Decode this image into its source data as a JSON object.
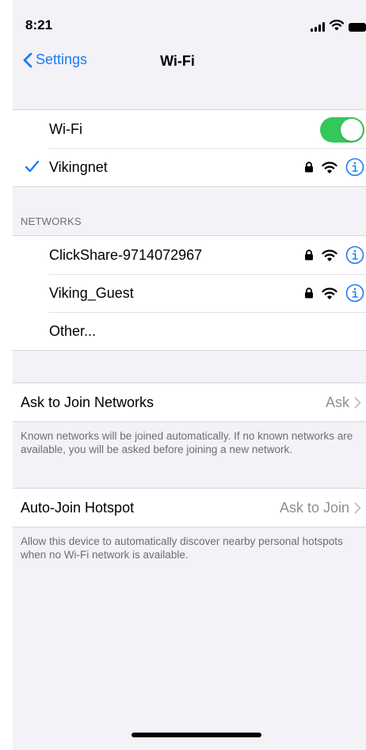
{
  "status_bar": {
    "time": "8:21"
  },
  "nav": {
    "back_label": "Settings",
    "title": "Wi-Fi"
  },
  "wifi_toggle": {
    "label": "Wi-Fi",
    "enabled": true,
    "on_color": "#34c759"
  },
  "connected_network": {
    "name": "Vikingnet",
    "secured": true,
    "icons": [
      "checkmark-icon",
      "lock-icon",
      "wifi-icon",
      "info-icon"
    ]
  },
  "networks_section": {
    "header": "NETWORKS",
    "items": [
      {
        "name": "ClickShare-9714072967",
        "secured": true
      },
      {
        "name": "Viking_Guest",
        "secured": true
      },
      {
        "name": "Other..."
      }
    ]
  },
  "ask_to_join": {
    "label": "Ask to Join Networks",
    "value": "Ask",
    "footnote": "Known networks will be joined automatically. If no known networks are available, you will be asked before joining a new network."
  },
  "auto_join_hotspot": {
    "label": "Auto-Join Hotspot",
    "value": "Ask to Join",
    "footnote": "Allow this device to automatically discover nearby personal hotspots when no Wi-Fi network is available."
  },
  "colors": {
    "accent": "#1a7cf5",
    "background": "#f2f2f7",
    "secondary_text": "#8e8e93"
  }
}
